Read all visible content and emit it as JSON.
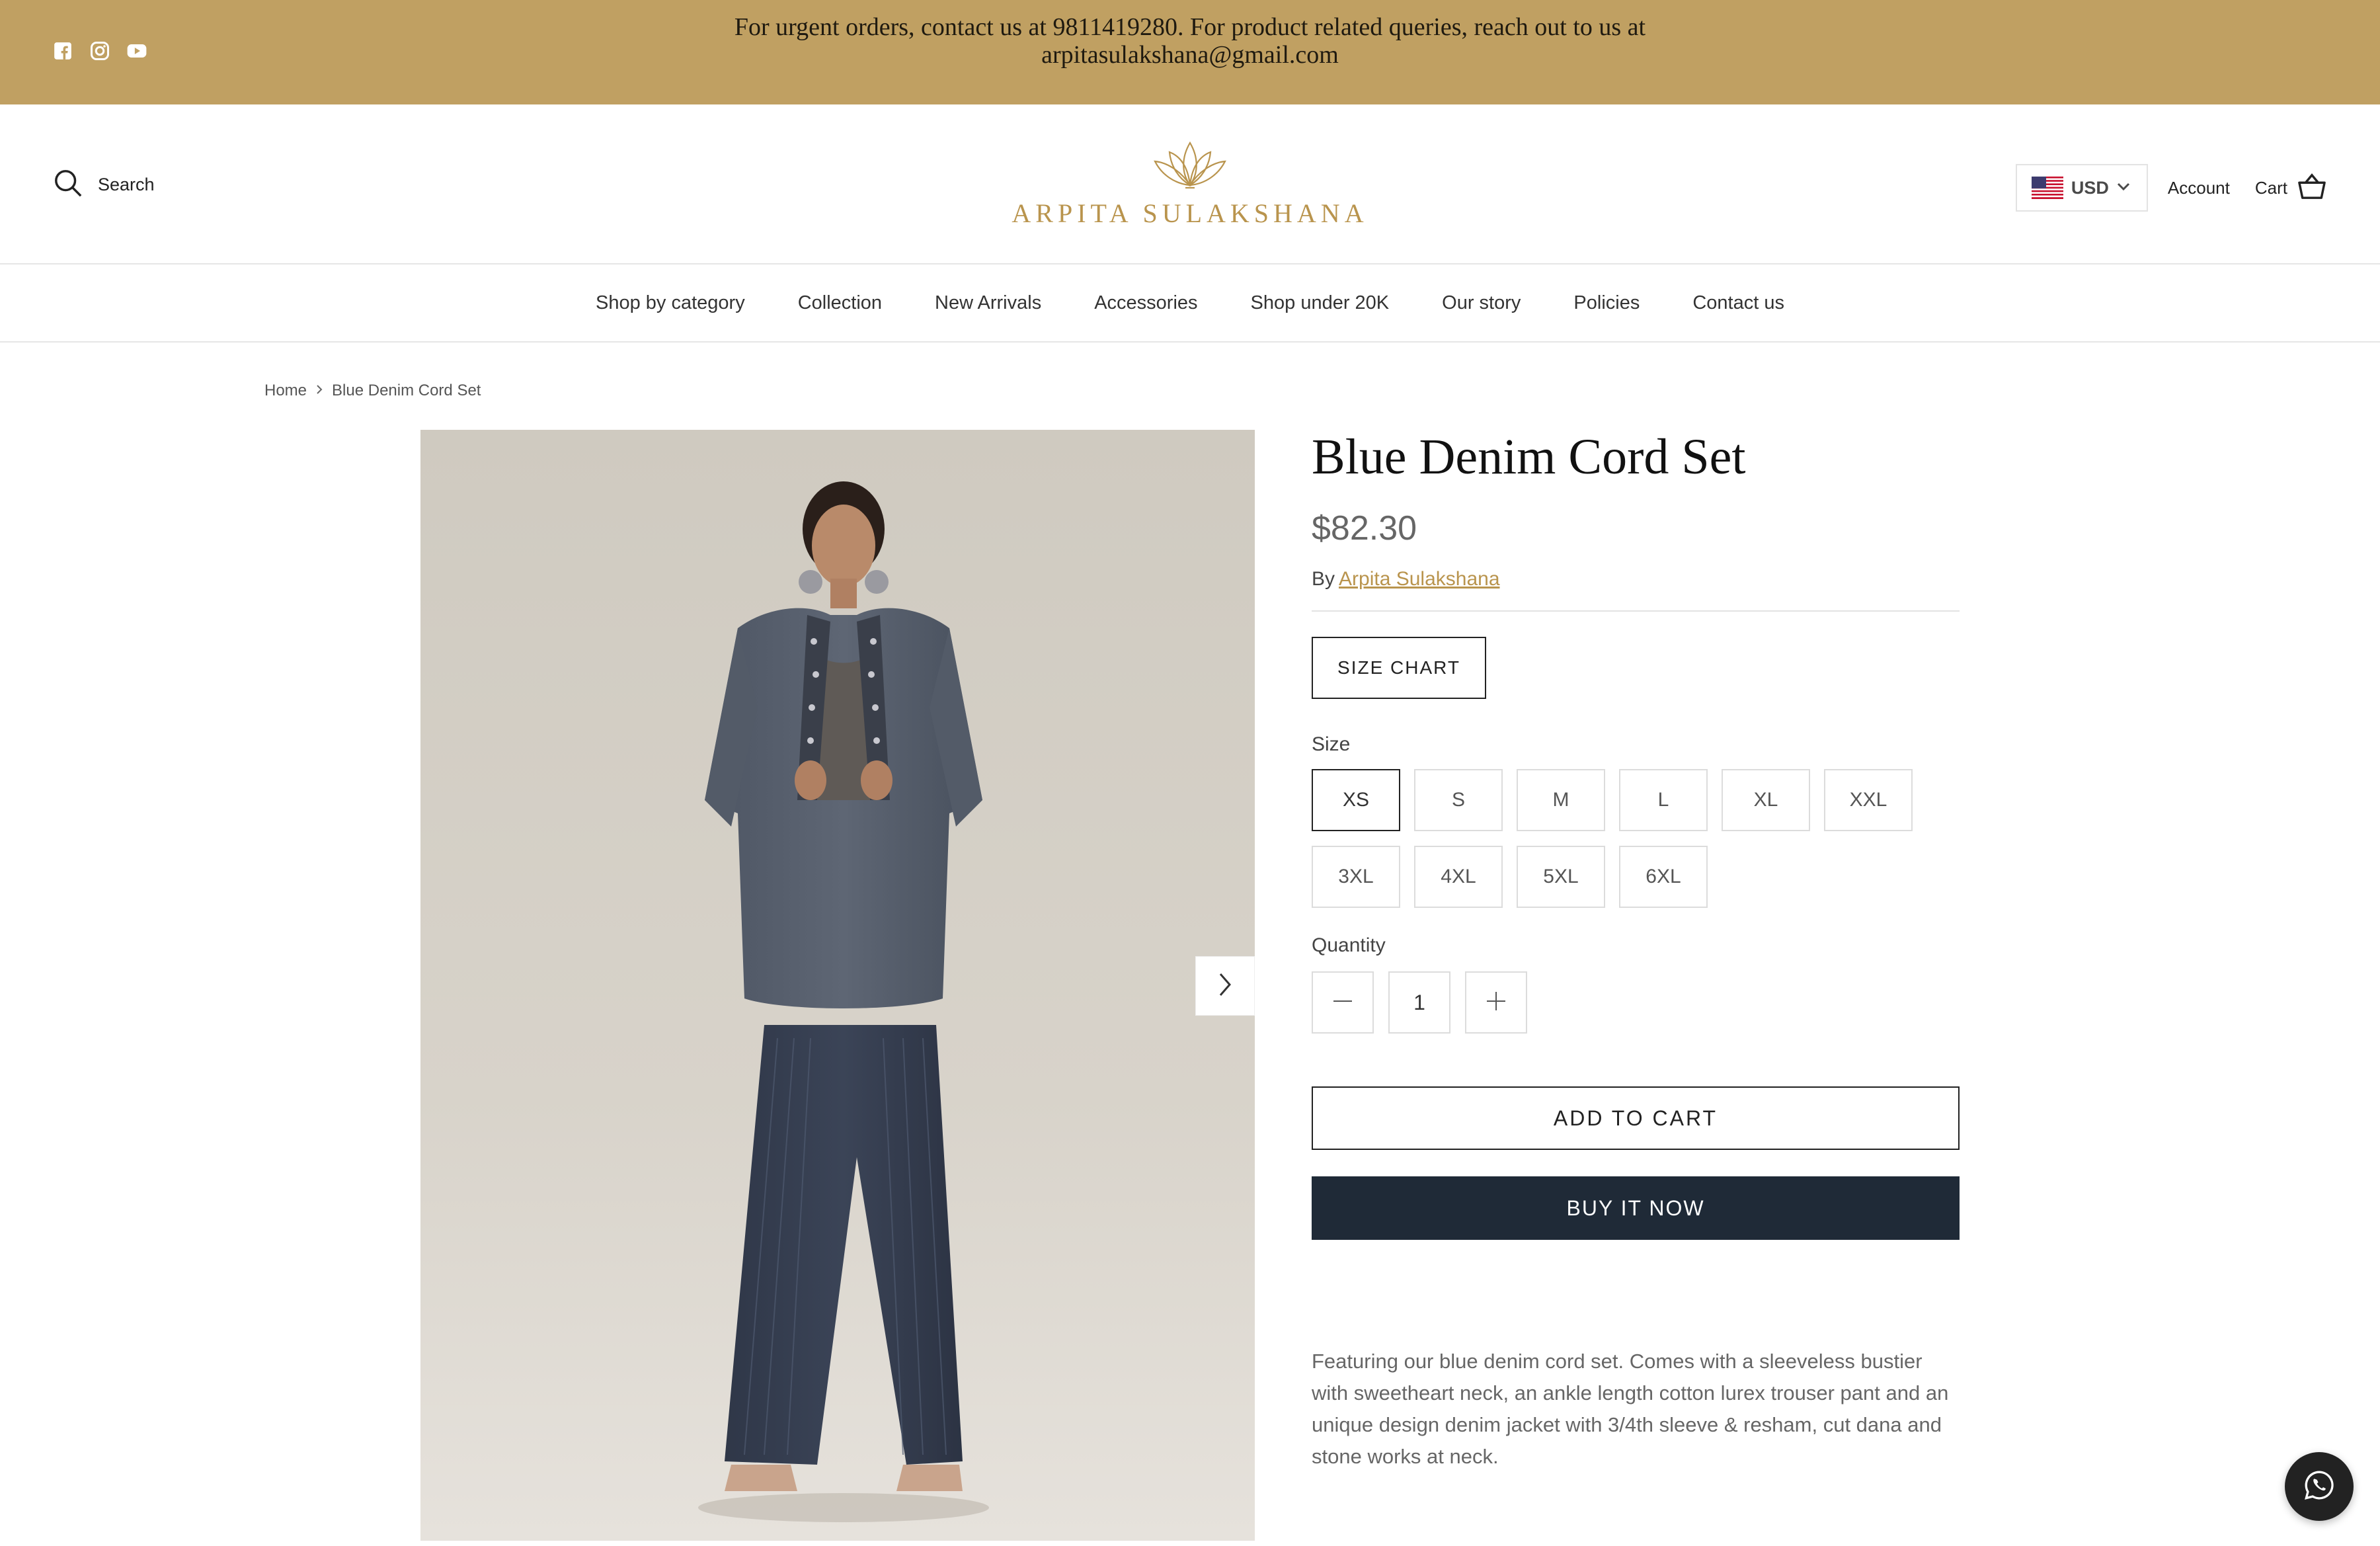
{
  "announcement": {
    "line1": "For urgent orders, contact us at 9811419280. For product related queries, reach out to us at",
    "line2": "arpitasulakshana@gmail.com"
  },
  "social_icons": [
    "facebook-icon",
    "instagram-icon",
    "youtube-icon"
  ],
  "header": {
    "search_label": "Search",
    "logo_text": "ARPITA SULAKSHANA",
    "currency": "USD",
    "account_label": "Account",
    "cart_label": "Cart"
  },
  "nav": {
    "items": [
      {
        "label": "Shop by category"
      },
      {
        "label": "Collection"
      },
      {
        "label": "New Arrivals"
      },
      {
        "label": "Accessories"
      },
      {
        "label": "Shop under 20K"
      },
      {
        "label": "Our story"
      },
      {
        "label": "Policies"
      },
      {
        "label": "Contact us"
      }
    ]
  },
  "breadcrumb": {
    "home": "Home",
    "current": "Blue Denim Cord Set"
  },
  "product": {
    "title": "Blue Denim Cord Set",
    "price": "$82.30",
    "by_prefix": "By",
    "brand": "Arpita Sulakshana",
    "size_chart_label": "SIZE CHART",
    "size_label": "Size",
    "sizes": [
      "XS",
      "S",
      "M",
      "L",
      "XL",
      "XXL",
      "3XL",
      "4XL",
      "5XL",
      "6XL"
    ],
    "selected_size": "XS",
    "quantity_label": "Quantity",
    "quantity": "1",
    "add_to_cart": "ADD TO CART",
    "buy_now": "BUY IT NOW",
    "description": "Featuring our blue denim cord set. Comes with a sleeveless bustier with sweetheart neck, an ankle length cotton lurex trouser pant and an unique design denim jacket with 3/4th sleeve & resham, cut dana and stone works at neck."
  },
  "colors": {
    "announcement_bg": "#c0a062",
    "brand_gold": "#b9944d",
    "buy_now_bg": "#1f2a37"
  }
}
